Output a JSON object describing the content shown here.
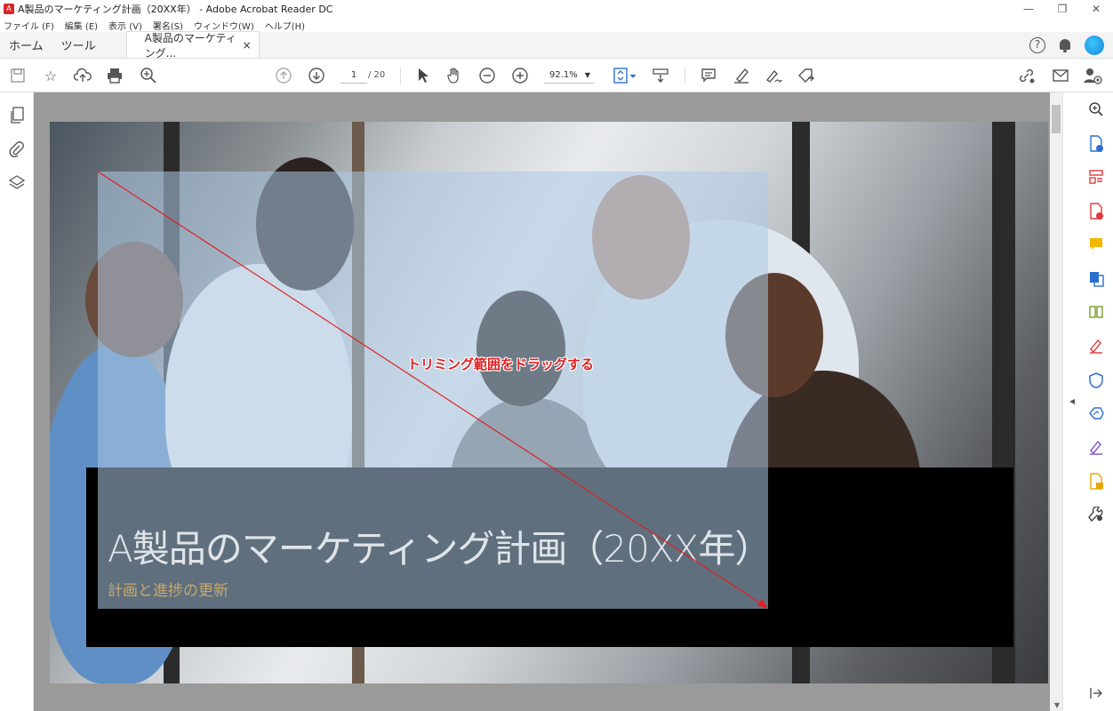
{
  "window": {
    "title": "A製品のマーケティング計画（20XX年） - Adobe Acrobat Reader DC",
    "minimize": "—",
    "maximize": "❐",
    "close": "✕"
  },
  "menu": [
    "ファイル (F)",
    "編集 (E)",
    "表示 (V)",
    "署名(S)",
    "ウィンドウ(W)",
    "ヘルプ(H)"
  ],
  "tabs": {
    "home": "ホーム",
    "tools": "ツール",
    "document": "A製品のマーケティング...",
    "close": "×"
  },
  "toolbar": {
    "page_current": "1",
    "page_total": "/ 20",
    "zoom": "92.1%"
  },
  "page": {
    "title": "A製品のマーケティング計画（20XX年）",
    "subtitle": "計画と進捗の更新",
    "annotation": "トリミング範囲をドラッグする"
  },
  "colors": {
    "selection": "#adcbe6",
    "annotation": "#e02020",
    "subtitle": "#c9a86a"
  }
}
